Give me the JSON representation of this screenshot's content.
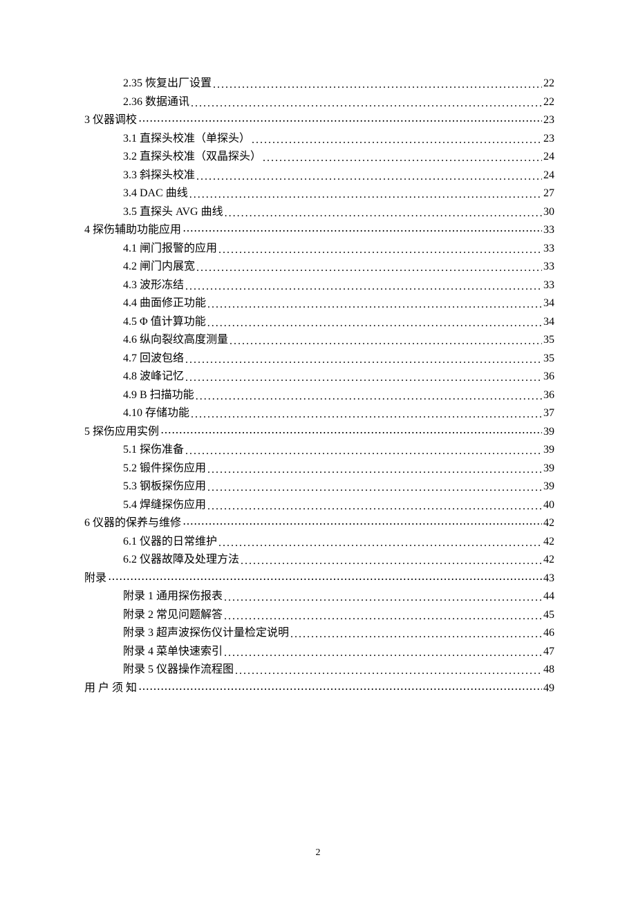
{
  "toc": [
    {
      "label": "2.35 恢复出厂设置",
      "page": "22",
      "indent": 1,
      "dots": "latin"
    },
    {
      "label": "2.36 数据通讯",
      "page": "22",
      "indent": 1,
      "dots": "latin"
    },
    {
      "label": "3 仪器调校",
      "page": "23",
      "indent": 0,
      "dots": "cjk"
    },
    {
      "label": "3.1 直探头校准（单探头）",
      "page": "23",
      "indent": 1,
      "dots": "latin"
    },
    {
      "label": "3.2 直探头校准（双晶探头）",
      "page": "24",
      "indent": 1,
      "dots": "latin"
    },
    {
      "label": "3.3 斜探头校准",
      "page": "24",
      "indent": 1,
      "dots": "latin"
    },
    {
      "label": "3.4 DAC 曲线",
      "page": "27",
      "indent": 1,
      "dots": "latin"
    },
    {
      "label": "3.5 直探头 AVG 曲线",
      "page": "30",
      "indent": 1,
      "dots": "latin"
    },
    {
      "label": "4  探伤辅助功能应用",
      "page": "33",
      "indent": 0,
      "dots": "cjk"
    },
    {
      "label": "4.1 闸门报警的应用",
      "page": "33",
      "indent": 1,
      "dots": "latin"
    },
    {
      "label": "4.2 闸门内展宽",
      "page": "33",
      "indent": 1,
      "dots": "latin"
    },
    {
      "label": "4.3 波形冻结",
      "page": "33",
      "indent": 1,
      "dots": "latin"
    },
    {
      "label": "4.4 曲面修正功能",
      "page": "34",
      "indent": 1,
      "dots": "latin"
    },
    {
      "label": "4.5 Φ 值计算功能",
      "page": "34",
      "indent": 1,
      "dots": "latin"
    },
    {
      "label": "4.6 纵向裂纹高度测量",
      "page": "35",
      "indent": 1,
      "dots": "latin"
    },
    {
      "label": "4.7 回波包络",
      "page": "35",
      "indent": 1,
      "dots": "latin"
    },
    {
      "label": "4.8 波峰记忆",
      "page": "36",
      "indent": 1,
      "dots": "latin"
    },
    {
      "label": "4.9 B 扫描功能",
      "page": "36",
      "indent": 1,
      "dots": "latin"
    },
    {
      "label": "4.10 存储功能",
      "page": "37",
      "indent": 1,
      "dots": "latin"
    },
    {
      "label": "5  探伤应用实例",
      "page": "39",
      "indent": 0,
      "dots": "cjk"
    },
    {
      "label": "5.1 探伤准备",
      "page": "39",
      "indent": 1,
      "dots": "latin"
    },
    {
      "label": "5.2 锻件探伤应用",
      "page": "39",
      "indent": 1,
      "dots": "latin"
    },
    {
      "label": "5.3 钢板探伤应用",
      "page": "39",
      "indent": 1,
      "dots": "latin"
    },
    {
      "label": "5.4 焊缝探伤应用",
      "page": "40",
      "indent": 1,
      "dots": "latin"
    },
    {
      "label": "6 仪器的保养与维修",
      "page": "42",
      "indent": 0,
      "dots": "cjk"
    },
    {
      "label": "6.1 仪器的日常维护",
      "page": "42",
      "indent": 1,
      "dots": "latin"
    },
    {
      "label": "6.2 仪器故障及处理方法",
      "page": "42",
      "indent": 1,
      "dots": "latin"
    },
    {
      "label": "附录",
      "page": "43",
      "indent": 0,
      "dots": "cjk"
    },
    {
      "label": "附录 1 通用探伤报表",
      "page": "44",
      "indent": 2,
      "dots": "latin"
    },
    {
      "label": "附录 2  常见问题解答",
      "page": "45",
      "indent": 2,
      "dots": "latin"
    },
    {
      "label": "附录 3  超声波探伤仪计量检定说明",
      "page": "46",
      "indent": 2,
      "dots": "latin"
    },
    {
      "label": "附录 4  菜单快速索引",
      "page": "47",
      "indent": 2,
      "dots": "latin"
    },
    {
      "label": "附录 5  仪器操作流程图",
      "page": "48",
      "indent": 2,
      "dots": "latin"
    },
    {
      "label": "用 户 须 知",
      "page": "49",
      "indent": 0,
      "dots": "cjk"
    }
  ],
  "page_number": "2"
}
